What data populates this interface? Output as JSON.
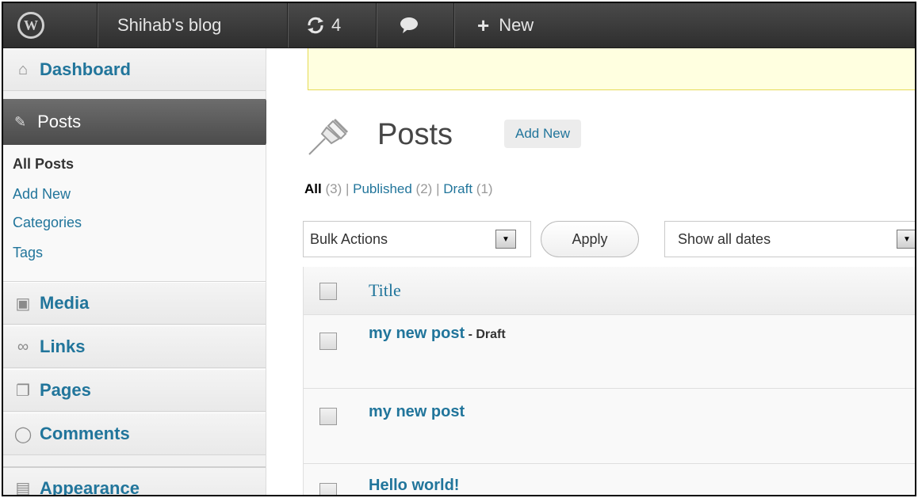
{
  "adminbar": {
    "site_name": "Shihab's blog",
    "updates_count": "4",
    "new_label": "New"
  },
  "sidebar": {
    "dashboard": "Dashboard",
    "posts": "Posts",
    "submenu": {
      "all_posts": "All Posts",
      "add_new": "Add New",
      "categories": "Categories",
      "tags": "Tags"
    },
    "media": "Media",
    "links": "Links",
    "pages": "Pages",
    "comments": "Comments",
    "appearance": "Appearance"
  },
  "main": {
    "title": "Posts",
    "add_new": "Add New",
    "filters": {
      "all_label": "All",
      "all_count": "(3)",
      "sep": "|",
      "published_label": "Published",
      "published_count": "(2)",
      "draft_label": "Draft",
      "draft_count": "(1)"
    },
    "bulk_actions": "Bulk Actions",
    "apply": "Apply",
    "dates": "Show all dates",
    "table": {
      "title_header": "Title",
      "rows": [
        {
          "title": "my new post",
          "state": " - Draft"
        },
        {
          "title": "my new post",
          "state": ""
        },
        {
          "title": "Hello world!",
          "state": ""
        }
      ]
    }
  }
}
